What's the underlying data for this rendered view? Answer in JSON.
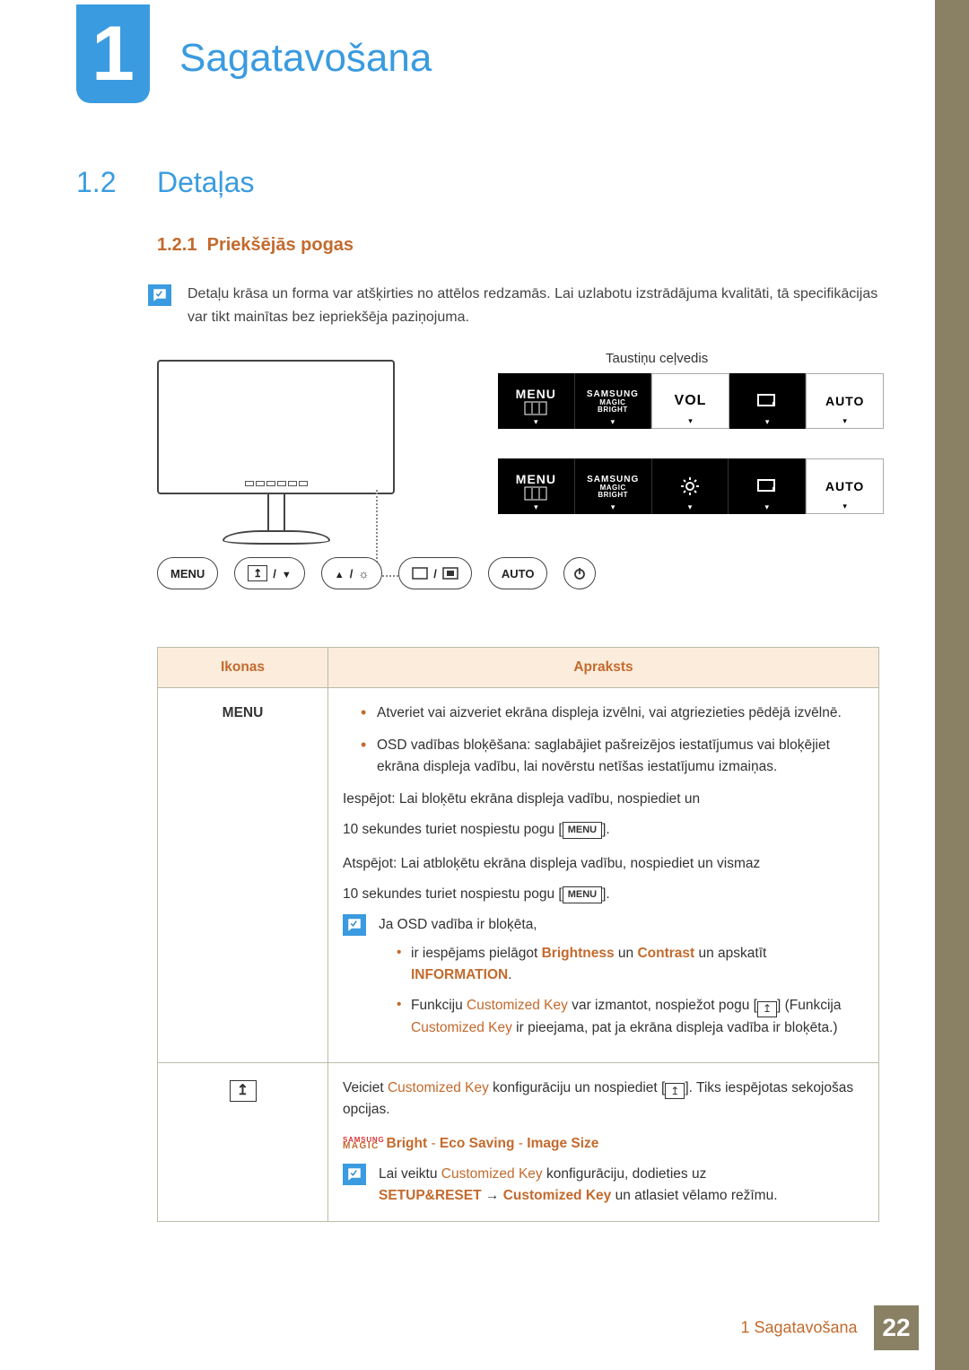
{
  "chapter": {
    "number": "1",
    "title": "Sagatavošana"
  },
  "section": {
    "num": "1.2",
    "title": "Detaļas"
  },
  "subsection": {
    "num": "1.2.1",
    "title": "Priekšējās pogas"
  },
  "intro_note": "Detaļu krāsa un forma var atšķirties no attēlos redzamās. Lai uzlabotu izstrādājuma kvalitāti, tā specifikācijas var tikt mainītas bez iepriekšēja paziņojuma.",
  "diagram": {
    "guide_label": "Taustiņu ceļvedis",
    "osd_row1": [
      "MENU",
      "SAMSUNG MAGIC BRIGHT",
      "VOL",
      "⟲",
      "AUTO"
    ],
    "osd_row2": [
      "MENU",
      "SAMSUNG MAGIC BRIGHT",
      "☼",
      "⟲",
      "AUTO"
    ],
    "buttons": {
      "menu": "MENU",
      "auto": "AUTO"
    }
  },
  "table": {
    "headers": {
      "icons": "Ikonas",
      "desc": "Apraksts"
    },
    "row1": {
      "icon": "MENU",
      "b1": "Atveriet vai aizveriet ekrāna displeja izvēlni, vai atgriezieties pēdējā izvēlnē.",
      "b2": "OSD vadības bloķēšana: saglabājiet pašreizējos iestatījumus vai bloķējiet ekrāna displeja vadību, lai novērstu netīšas iestatījumu izmaiņas.",
      "enable": "Iespējot: Lai bloķētu ekrāna displeja vadību, nospiediet un",
      "hold1_pre": "10 sekundes turiet nospiestu pogu [",
      "hold1_chip": "MENU",
      "hold1_post": "].",
      "disable": "Atspējot: Lai atbloķētu ekrāna displeja vadību, nospiediet un vismaz",
      "hold2_pre": "10 sekundes turiet nospiestu pogu [",
      "hold2_chip": "MENU",
      "hold2_post": "].",
      "nested_note_lead": "Ja OSD vadība ir bloķēta,",
      "nested_li1_a": "ir iespējams pielāgot ",
      "nested_li1_b": "Brightness",
      "nested_li1_c": " un ",
      "nested_li1_d": "Contrast",
      "nested_li1_e": " un apskatīt ",
      "nested_li1_f": "INFORMATION",
      "nested_li1_g": ".",
      "nested_li2_a": "Funkciju ",
      "nested_li2_b": "Customized Key",
      "nested_li2_c": " var izmantot, nospiežot pogu [",
      "nested_li2_d": "] (Funkcija ",
      "nested_li2_e": "Customized Key",
      "nested_li2_f": " ir pieejama, pat ja ekrāna displeja vadība ir bloķēta.)"
    },
    "row2": {
      "p1_a": "Veiciet ",
      "p1_b": "Customized Key",
      "p1_c": " konfigurāciju un nospiediet [",
      "p1_d": "]. Tiks iespējotas sekojošas opcijas.",
      "options_bright": "Bright",
      "options_sep": " - ",
      "options_eco": "Eco Saving",
      "options_img": "Image Size",
      "note_a": "Lai veiktu ",
      "note_b": "Customized Key",
      "note_c": " konfigurāciju, dodieties uz ",
      "note_d": "SETUP&RESET",
      "note_arrow": " → ",
      "note_e": "Customized Key",
      "note_f": " un atlasiet vēlamo režīmu."
    }
  },
  "footer": {
    "text": "1 Sagatavošana",
    "page": "22"
  }
}
